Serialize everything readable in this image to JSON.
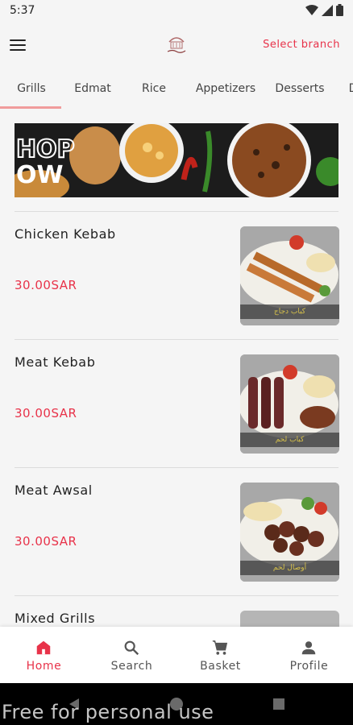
{
  "status": {
    "time": "5:37"
  },
  "header": {
    "select_branch": "Select branch"
  },
  "tabs": [
    {
      "label": "Grills"
    },
    {
      "label": "Edmat"
    },
    {
      "label": "Rice"
    },
    {
      "label": "Appetizers"
    },
    {
      "label": "Desserts"
    },
    {
      "label": "D"
    }
  ],
  "banner": {
    "text_line1": "HOP",
    "text_line2": "OW"
  },
  "items": [
    {
      "name": "Chicken Kebab",
      "price": "30.00SAR",
      "caption": "كباب دجاج"
    },
    {
      "name": "Meat Kebab",
      "price": "30.00SAR",
      "caption": "كباب لحم"
    },
    {
      "name": "Meat Awsal",
      "price": "30.00SAR",
      "caption": "أوصال لحم"
    },
    {
      "name": "Mixed Grills",
      "price": "",
      "caption": ""
    }
  ],
  "bottom_nav": [
    {
      "label": "Home",
      "icon": "home-icon"
    },
    {
      "label": "Search",
      "icon": "search-icon"
    },
    {
      "label": "Basket",
      "icon": "cart-icon"
    },
    {
      "label": "Profile",
      "icon": "person-icon"
    }
  ],
  "watermark": "Free for personal use",
  "colors": {
    "accent": "#e8334a",
    "price": "#e8334a",
    "tab_indicator": "#f09c9c"
  }
}
